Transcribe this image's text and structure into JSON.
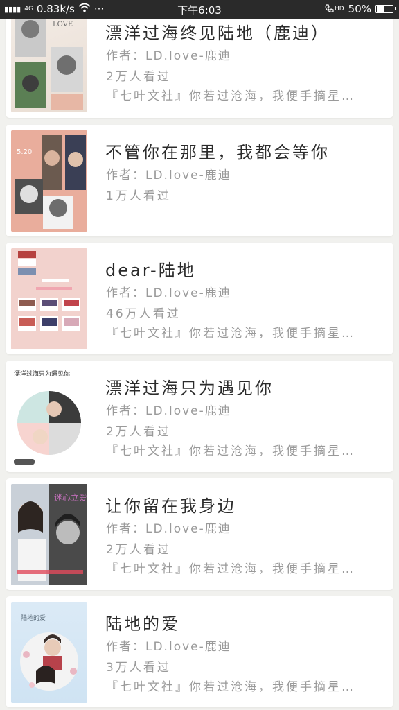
{
  "status_bar": {
    "signal": "4G",
    "speed": "0.83k/s",
    "more": "···",
    "time": "下午6:03",
    "hd": "HD",
    "battery_percent": 50,
    "battery_text": "50%"
  },
  "books": [
    {
      "title": "漂洋过海终见陆地（鹿迪）",
      "author": "作者：LD.love-鹿迪",
      "readers": "2万人看过",
      "description": "『七叶文社』你若过沧海，我便手摘星…",
      "cover_text": "LOVE"
    },
    {
      "title": "不管你在那里，我都会等你",
      "author": "作者：LD.love-鹿迪",
      "readers": "1万人看过",
      "description": "",
      "cover_text": "5.20"
    },
    {
      "title": "dear-陆地",
      "author": "作者：LD.love-鹿迪",
      "readers": "46万人看过",
      "description": "『七叶文社』你若过沧海，我便手摘星…",
      "cover_text": ""
    },
    {
      "title": "漂洋过海只为遇见你",
      "author": "作者：LD.love-鹿迪",
      "readers": "2万人看过",
      "description": "『七叶文社』你若过沧海，我便手摘星…",
      "cover_text": "漂洋过海只为遇见你"
    },
    {
      "title": "让你留在我身边",
      "author": "作者：LD.love-鹿迪",
      "readers": "2万人看过",
      "description": "『七叶文社』你若过沧海，我便手摘星…",
      "cover_text": "迷心立爱"
    },
    {
      "title": "陆地的爱",
      "author": "作者：LD.love-鹿迪",
      "readers": "3万人看过",
      "description": "『七叶文社』你若过沧海，我便手摘星…",
      "cover_text": "陆地的爱"
    }
  ]
}
